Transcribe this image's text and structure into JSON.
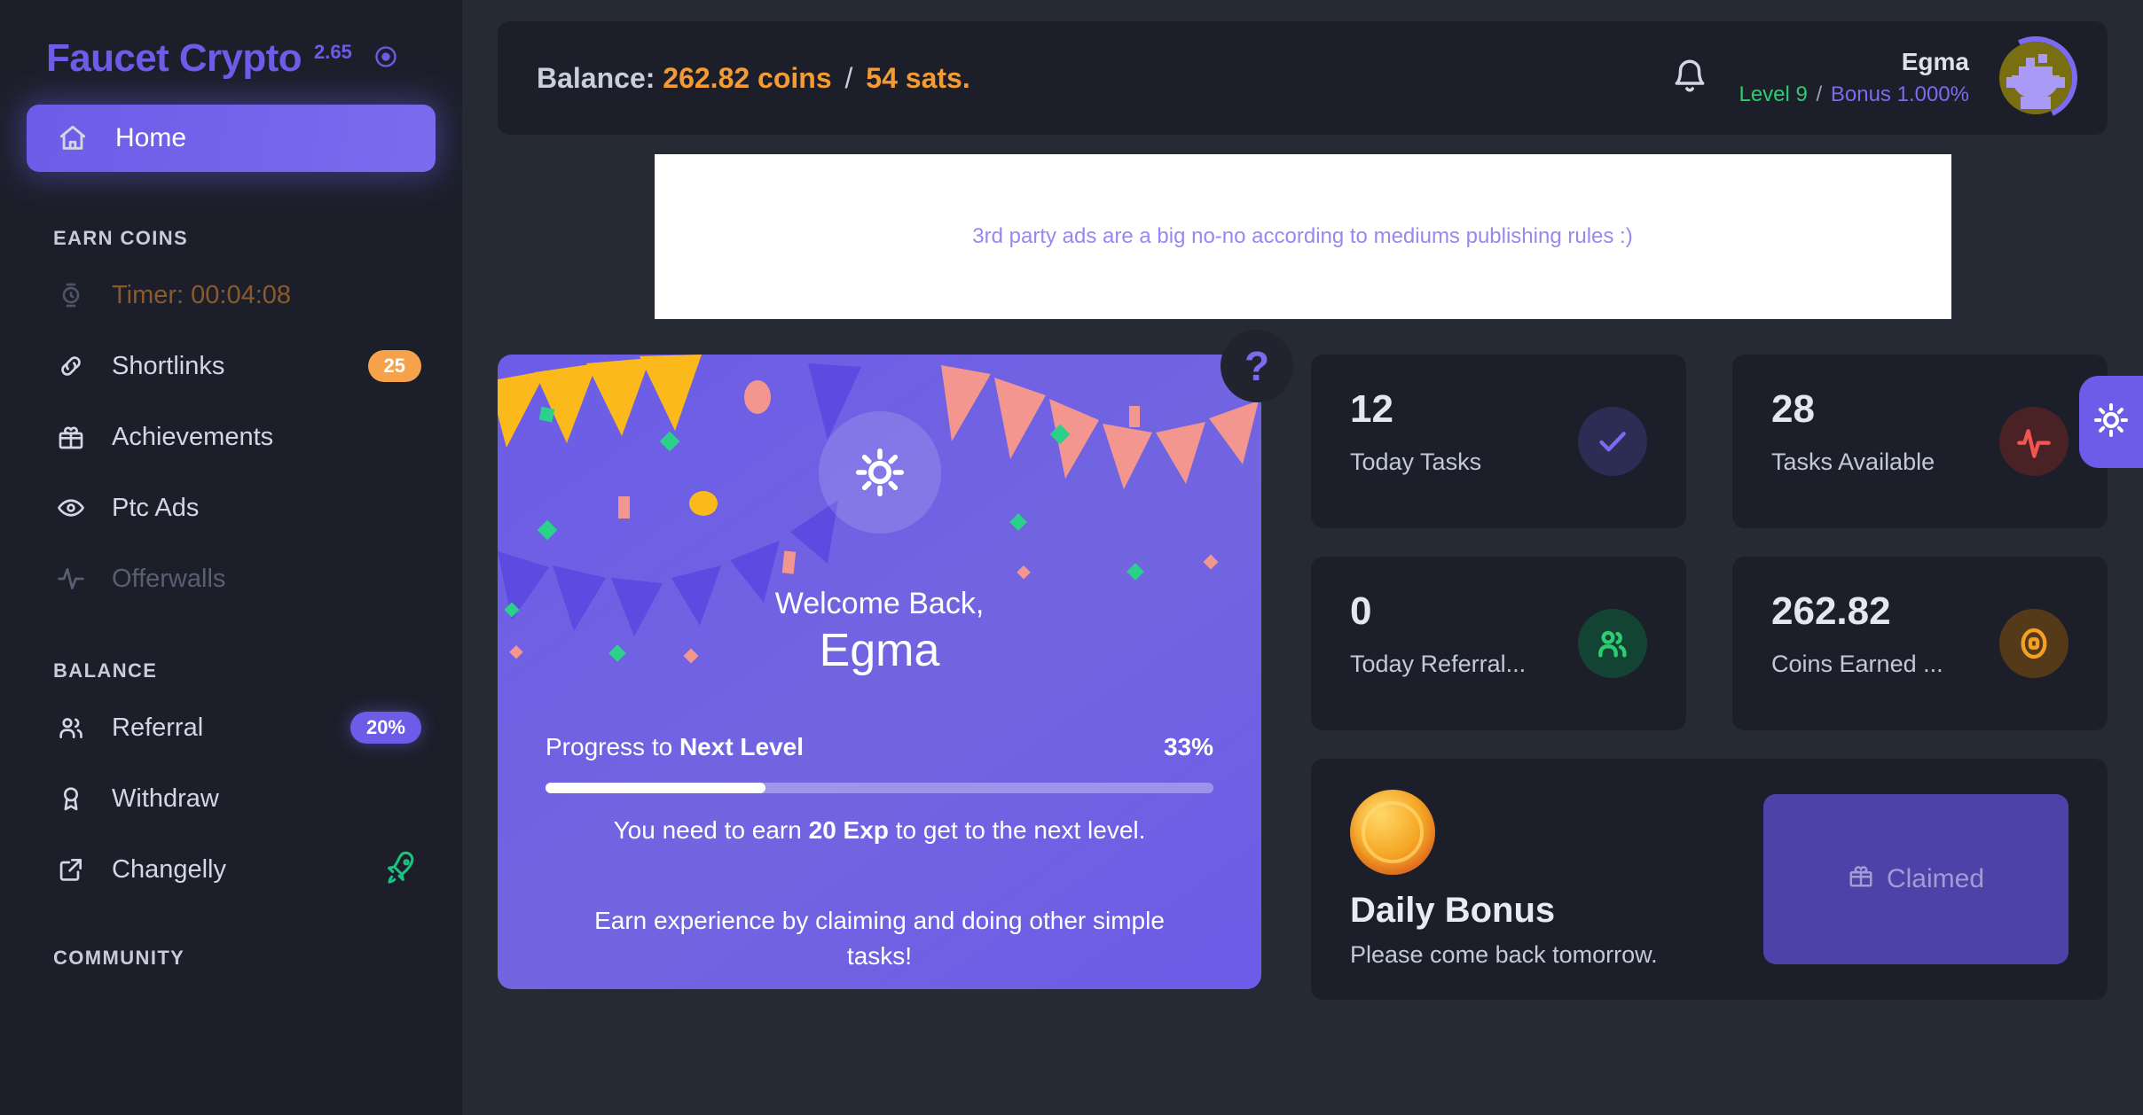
{
  "brand": {
    "name": "Faucet Crypto",
    "version": "2.65",
    "logo_icon": "target-dot-icon"
  },
  "sidebar": {
    "active_item": {
      "label": "Home",
      "icon": "home-icon"
    },
    "sections": [
      {
        "title": "EARN COINS",
        "items": [
          {
            "label": "Timer: 00:04:08",
            "icon": "watch-icon",
            "state": "timer"
          },
          {
            "label": "Shortlinks",
            "icon": "link-icon",
            "badge": "25",
            "badge_color": "#F5A24B"
          },
          {
            "label": "Achievements",
            "icon": "gift-icon"
          },
          {
            "label": "Ptc Ads",
            "icon": "eye-icon"
          },
          {
            "label": "Offerwalls",
            "icon": "activity-icon",
            "state": "disabled"
          }
        ]
      },
      {
        "title": "BALANCE",
        "items": [
          {
            "label": "Referral",
            "icon": "users-icon",
            "badge": "20%",
            "badge_color": "#6C5CE7"
          },
          {
            "label": "Withdraw",
            "icon": "award-icon"
          },
          {
            "label": "Changelly",
            "icon": "external-link-icon",
            "accessory_icon": "rocket-icon"
          }
        ]
      },
      {
        "title": "COMMUNITY",
        "items": []
      }
    ]
  },
  "topbar": {
    "balance_label": "Balance:",
    "coins": "262.82 coins",
    "separator": "/",
    "sats": "54 sats.",
    "bell_icon": "bell-icon",
    "user": {
      "name": "Egma",
      "level": "Level 9",
      "meta_separator": "/",
      "bonus": "Bonus 1.000%",
      "avatar_icon": "pixel-avatar"
    }
  },
  "ad_banner": {
    "text": "3rd party ads are a big no-no according to mediums publishing rules :)"
  },
  "welcome_card": {
    "help_label": "?",
    "sun_icon": "sun-icon",
    "greeting": "Welcome Back,",
    "username": "Egma",
    "progress_label_prefix": "Progress to ",
    "progress_label_strong": "Next Level",
    "progress_percent": "33%",
    "progress_value": 33,
    "progress_note_prefix": "You need to earn ",
    "progress_note_strong": "20 Exp",
    "progress_note_suffix": " to get to the next level.",
    "tip": "Earn experience by claiming and doing other simple tasks!"
  },
  "stats": [
    {
      "value": "12",
      "label": "Today Tasks",
      "icon": "check-icon",
      "color": "#7B6BEE"
    },
    {
      "value": "28",
      "label": "Tasks Available",
      "icon": "activity-icon",
      "color": "#F2544F"
    },
    {
      "value": "0",
      "label": "Today Referral...",
      "icon": "users-icon",
      "color": "#2ECC71"
    },
    {
      "value": "262.82",
      "label": "Coins Earned ...",
      "icon": "coin-icon",
      "color": "#F5A024"
    }
  ],
  "daily_bonus": {
    "coin_icon": "gold-coin-icon",
    "title": "Daily Bonus",
    "subtitle": "Please come back tomorrow.",
    "button_label": "Claimed",
    "button_icon": "gift-icon",
    "button_disabled": true
  },
  "theme_toggle": {
    "icon": "sun-icon",
    "mode": "light"
  }
}
